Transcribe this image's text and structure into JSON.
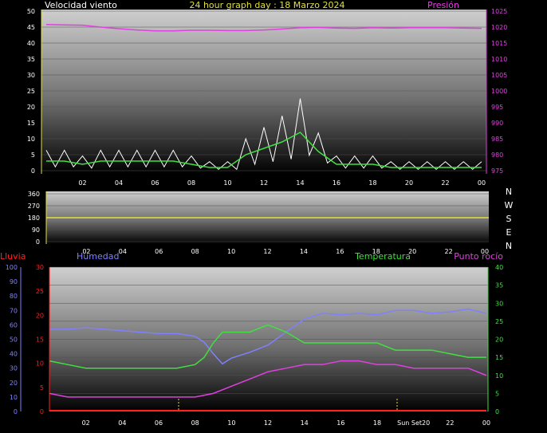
{
  "colors": {
    "background": "#000000",
    "white": "#ffffff",
    "magenta": "#e040e0",
    "lightblue": "#8080ff",
    "green": "#40e040",
    "red": "#ff2020",
    "yellow": "#e0e040",
    "grid": "#505050"
  },
  "top": {
    "title": "24 hour graph day : 18 Marzo 2024",
    "left_label": "Velocidad viento",
    "right_label": "Presión",
    "x_ticks": [
      "02",
      "04",
      "06",
      "08",
      "10",
      "12",
      "14",
      "16",
      "18",
      "20",
      "22",
      "00"
    ],
    "y_left_ticks": [
      "50",
      "45",
      "40",
      "35",
      "30",
      "25",
      "20",
      "15",
      "10",
      "5",
      "0"
    ],
    "y_right_ticks": [
      "1025",
      "1020",
      "1015",
      "1010",
      "1005",
      "1000",
      "995",
      "990",
      "985",
      "980",
      "975"
    ]
  },
  "mid": {
    "x_ticks": [
      "02",
      "04",
      "06",
      "08",
      "10",
      "12",
      "14",
      "16",
      "18",
      "20",
      "22",
      "00"
    ],
    "y_ticks": [
      "360",
      "270",
      "180",
      "90",
      "0"
    ],
    "compass": [
      "N",
      "W",
      "S",
      "E",
      "N"
    ]
  },
  "bottom": {
    "label_rain": "Lluvia",
    "label_humidity": "Humedad",
    "label_temp": "Temperatura",
    "label_dew": "Punto rocío",
    "x_ticks": [
      "02",
      "04",
      "06",
      "08",
      "10",
      "12",
      "14",
      "16",
      "18",
      "Sun Set20",
      "22",
      "00"
    ],
    "y_hum_ticks": [
      "100",
      "90",
      "80",
      "70",
      "60",
      "50",
      "40",
      "30",
      "20",
      "10",
      "0"
    ],
    "y_rain_ticks": [
      "30",
      "25",
      "20",
      "15",
      "10",
      "5",
      "0"
    ],
    "y_temp_ticks": [
      "40",
      "35",
      "30",
      "25",
      "20",
      "15",
      "10",
      "5",
      "0"
    ]
  },
  "chart_data": [
    {
      "type": "line",
      "x_unit": "hour",
      "xlim": [
        0,
        24
      ],
      "ylim_left": [
        0,
        50
      ],
      "ylim_right": [
        975,
        1025
      ],
      "series": [
        {
          "name": "Presión",
          "axis": "right",
          "x": [
            0,
            1,
            2,
            3,
            4,
            5,
            6,
            7,
            8,
            9,
            10,
            11,
            12,
            13,
            14,
            15,
            16,
            17,
            18,
            19,
            20,
            21,
            22,
            23,
            24
          ],
          "values": [
            1020.8,
            1020.7,
            1020.6,
            1020.0,
            1019.5,
            1019.1,
            1018.8,
            1018.8,
            1019.0,
            1019.0,
            1018.9,
            1018.9,
            1019.1,
            1019.4,
            1019.8,
            1019.9,
            1019.7,
            1019.6,
            1019.8,
            1019.7,
            1019.8,
            1019.8,
            1019.8,
            1019.7,
            1019.6
          ]
        },
        {
          "name": "Velocidad viento",
          "axis": "left",
          "x": [
            0,
            1,
            2,
            3,
            4,
            5,
            6,
            7,
            8,
            9,
            10,
            11,
            12,
            13,
            14,
            15,
            16,
            17,
            18,
            19,
            20,
            21,
            22,
            23,
            24
          ],
          "values": [
            3,
            3,
            2,
            3,
            3,
            3,
            3,
            3,
            2,
            1,
            1,
            5,
            7,
            9,
            12,
            6,
            2,
            2,
            2,
            1,
            1,
            1,
            1,
            1,
            1
          ]
        }
      ]
    },
    {
      "type": "line",
      "x_unit": "hour",
      "xlim": [
        0,
        24
      ],
      "ylim": [
        0,
        360
      ],
      "series": [
        {
          "name": "",
          "x": [
            0,
            24
          ],
          "values": [
            180,
            180
          ]
        }
      ]
    },
    {
      "type": "line",
      "x_unit": "hour",
      "xlim": [
        0,
        24
      ],
      "ylim_humidity": [
        0,
        100
      ],
      "ylim_temp": [
        0,
        40
      ],
      "ylim_rain": [
        0,
        30
      ],
      "series": [
        {
          "name": "Humedad",
          "axis": "humidity",
          "x": [
            0,
            1,
            2,
            3,
            4,
            5,
            6,
            7,
            8,
            8.5,
            9,
            9.5,
            10,
            11,
            12,
            13,
            14,
            15,
            16,
            17,
            18,
            19,
            20,
            21,
            22,
            23,
            24
          ],
          "values": [
            57,
            57,
            58,
            57,
            56,
            55,
            54,
            54,
            52,
            48,
            40,
            33,
            37,
            41,
            46,
            55,
            64,
            68,
            67,
            68,
            67,
            70,
            70,
            68,
            69,
            71,
            68
          ]
        },
        {
          "name": "Temperatura",
          "axis": "temp",
          "x": [
            0,
            1,
            2,
            3,
            4,
            5,
            6,
            7,
            8,
            8.5,
            9,
            9.5,
            10,
            11,
            12,
            13,
            14,
            15,
            16,
            17,
            18,
            19,
            20,
            21,
            22,
            23,
            24
          ],
          "values": [
            14,
            13,
            12,
            12,
            12,
            12,
            12,
            12,
            13,
            15,
            19,
            22,
            22,
            22,
            24,
            22,
            19,
            19,
            19,
            19,
            19,
            17,
            17,
            17,
            16,
            15,
            15
          ]
        },
        {
          "name": "Punto rocío",
          "axis": "temp",
          "x": [
            0,
            1,
            2,
            3,
            4,
            5,
            6,
            7,
            8,
            9,
            10,
            11,
            12,
            13,
            14,
            15,
            16,
            17,
            18,
            19,
            20,
            21,
            22,
            23,
            24
          ],
          "values": [
            5,
            4,
            4,
            4,
            4,
            4,
            4,
            4,
            4,
            5,
            7,
            9,
            11,
            12,
            13,
            13,
            14,
            14,
            13,
            13,
            12,
            12,
            12,
            12,
            10
          ]
        },
        {
          "name": "Lluvia",
          "axis": "rain",
          "x": [
            0,
            24
          ],
          "values": [
            0,
            0
          ]
        }
      ]
    }
  ]
}
